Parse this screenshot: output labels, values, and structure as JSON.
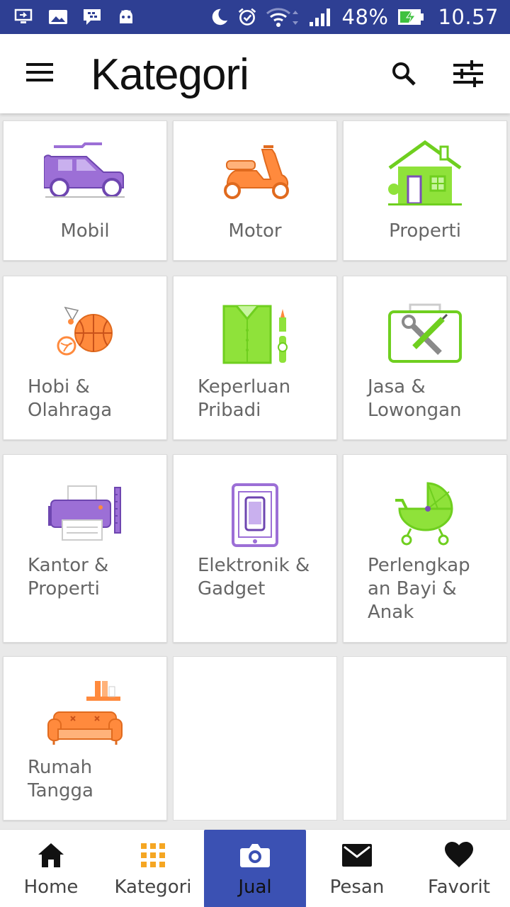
{
  "status_bar": {
    "battery": "48%",
    "time": "10.57",
    "icons": [
      "screen-share-icon",
      "image-icon",
      "bbm-icon",
      "android-icon",
      "moon-icon",
      "alarm-icon",
      "wifi-icon",
      "signal-icon",
      "battery-charging-icon"
    ]
  },
  "app_bar": {
    "title": "Kategori",
    "icons": [
      "menu-icon",
      "search-icon",
      "filter-icon"
    ]
  },
  "categories": [
    {
      "label": "Mobil",
      "icon": "car-icon",
      "color": "#9c6fd6"
    },
    {
      "label": "Motor",
      "icon": "scooter-icon",
      "color": "#ff8a3d"
    },
    {
      "label": "Properti",
      "icon": "house-icon",
      "color": "#8fe23a"
    },
    {
      "label": "Hobi &\nOlahraga",
      "icon": "sports-icon",
      "color": "#ff8a3d"
    },
    {
      "label": "Keperluan\nPribadi",
      "icon": "shirt-icon",
      "color": "#8fe23a"
    },
    {
      "label": "Jasa &\nLowongan",
      "icon": "toolbox-icon",
      "color": "#8fe23a"
    },
    {
      "label": "Kantor &\nProperti",
      "icon": "printer-icon",
      "color": "#9c6fd6"
    },
    {
      "label": "Elektronik &\nGadget",
      "icon": "tablet-icon",
      "color": "#9c6fd6"
    },
    {
      "label": "Perlengkap\nan Bayi &\nAnak",
      "icon": "stroller-icon",
      "color": "#8fe23a"
    },
    {
      "label": "Rumah\nTangga",
      "icon": "sofa-icon",
      "color": "#ff8a3d"
    }
  ],
  "bottom_nav": [
    {
      "label": "Home",
      "icon": "home-icon"
    },
    {
      "label": "Kategori",
      "icon": "grid-icon"
    },
    {
      "label": "Jual",
      "icon": "camera-icon",
      "active": true
    },
    {
      "label": "Pesan",
      "icon": "mail-icon"
    },
    {
      "label": "Favorit",
      "icon": "heart-icon"
    }
  ],
  "colors": {
    "status_bar": "#2e3f93",
    "active_nav": "#3b51b3",
    "purple": "#9c6fd6",
    "orange": "#ff8a3d",
    "green": "#8fe23a"
  }
}
